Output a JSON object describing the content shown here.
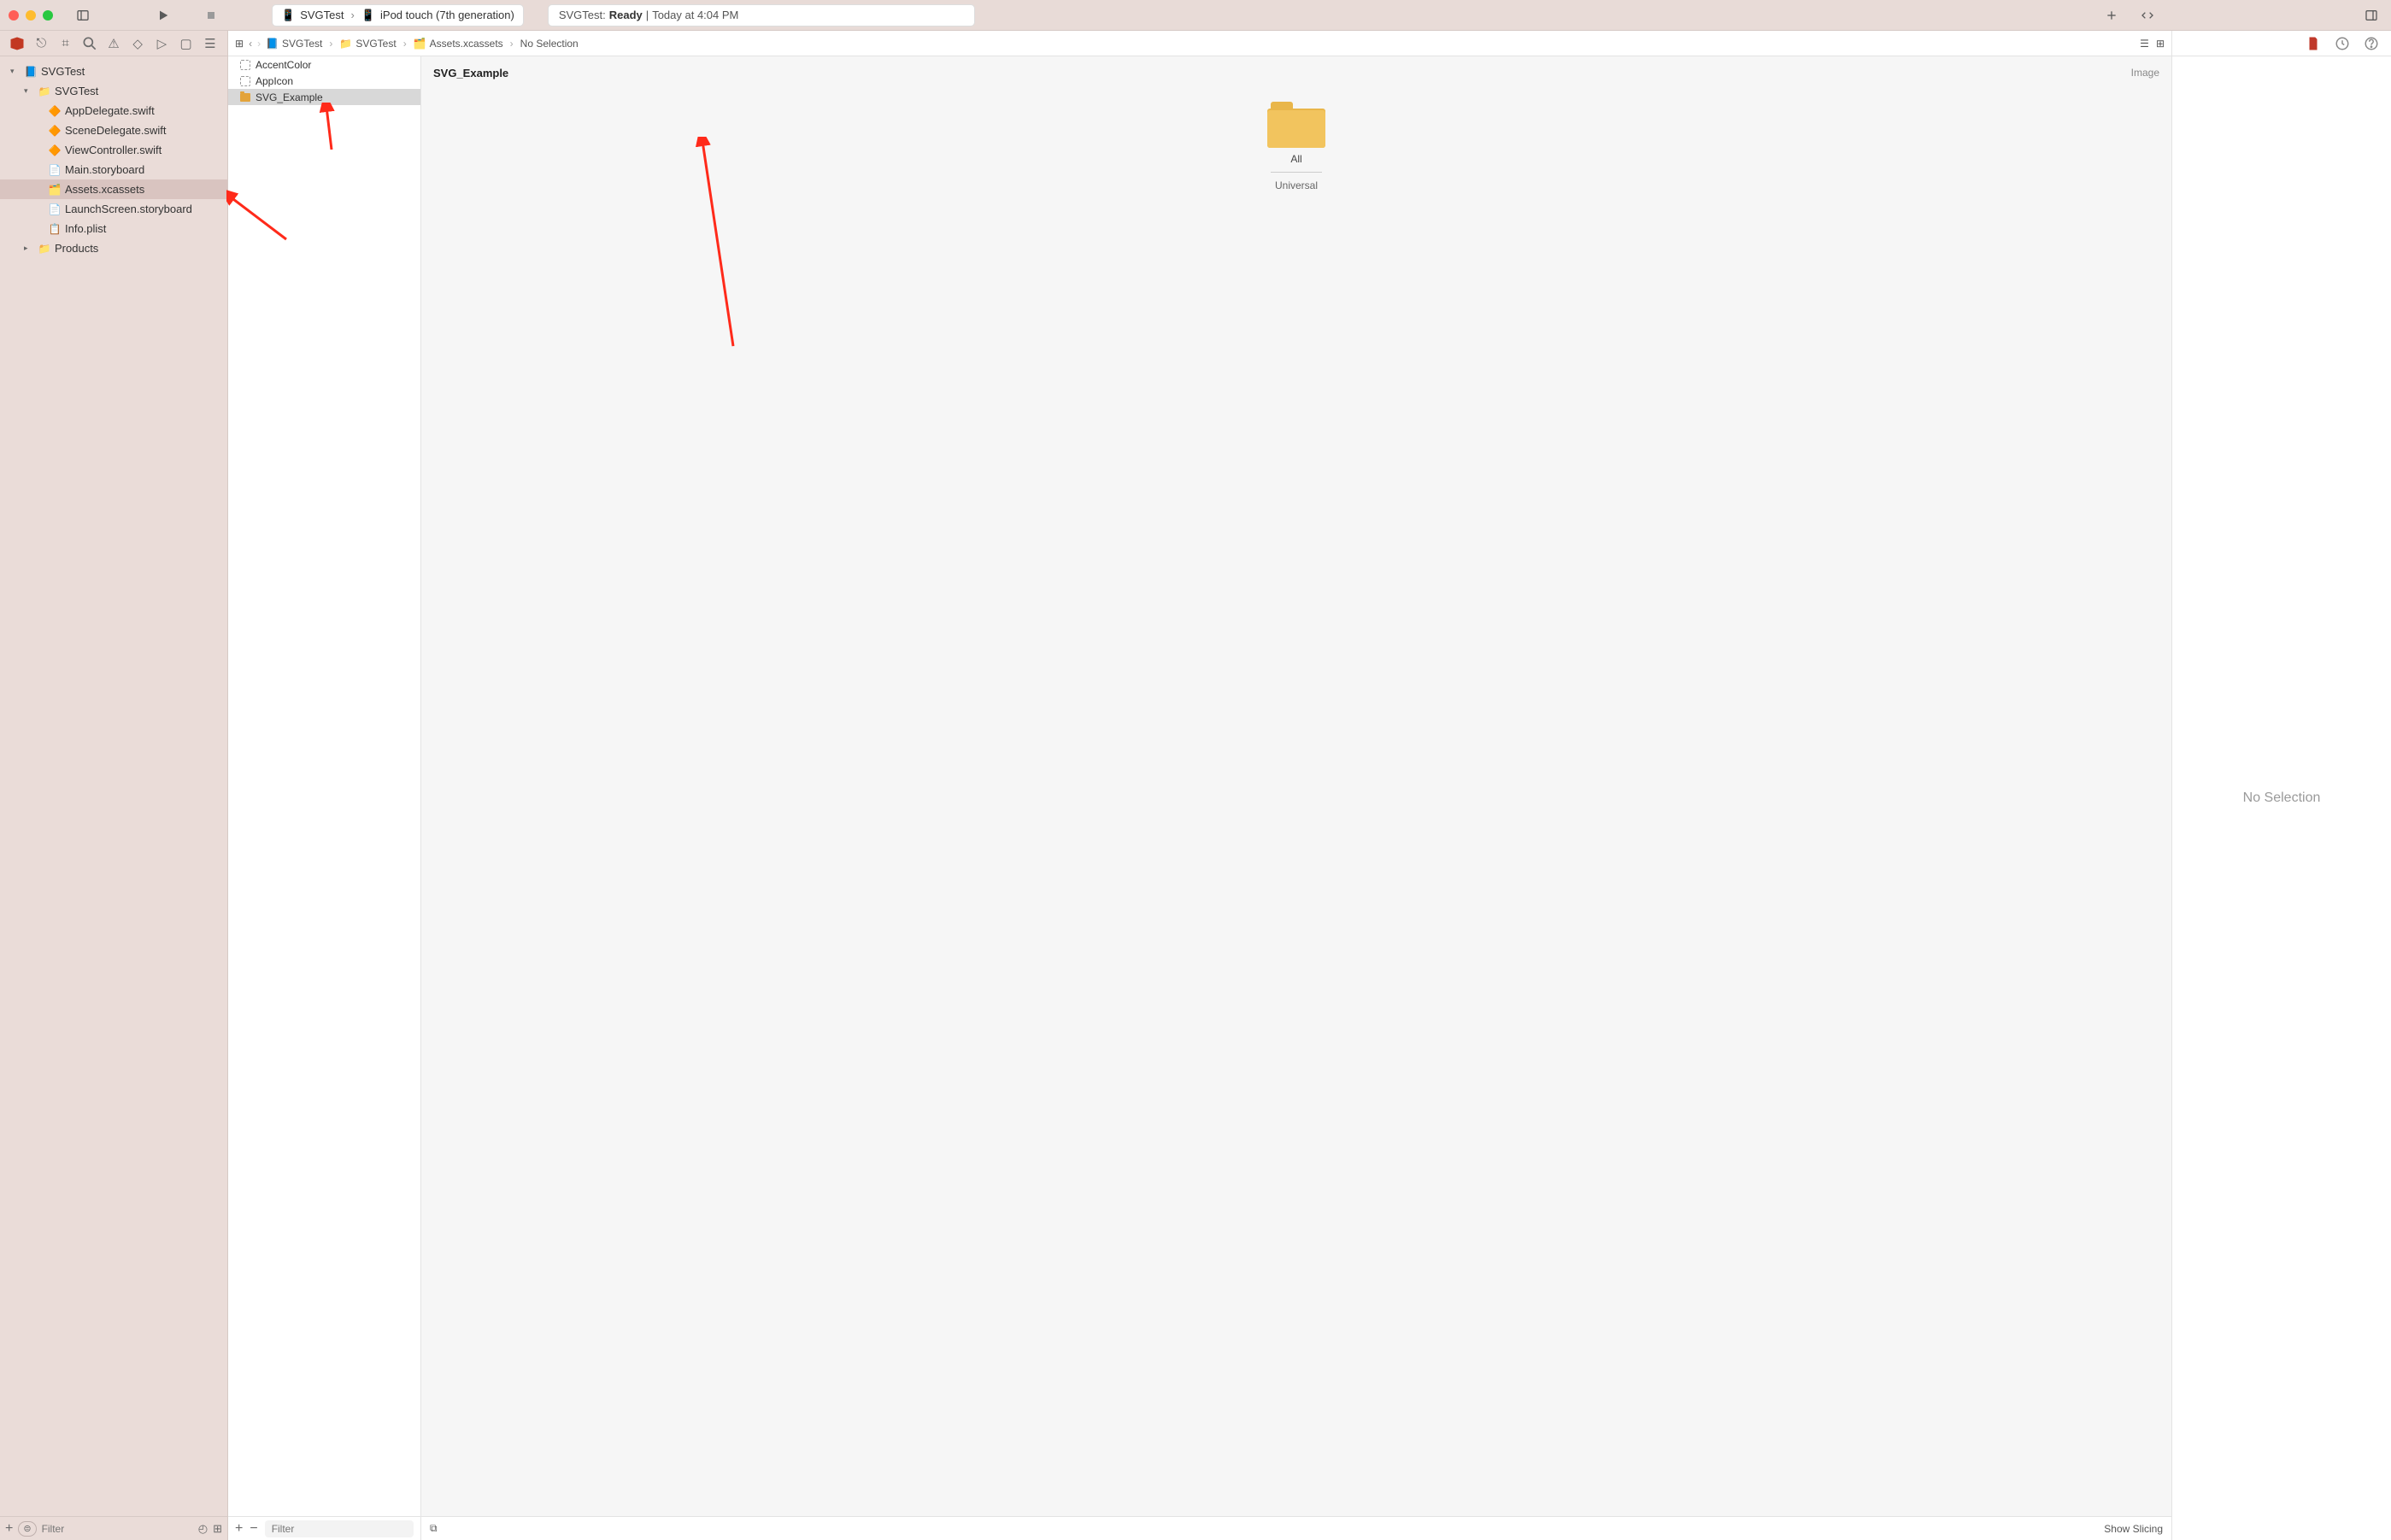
{
  "titlebar": {
    "scheme": "SVGTest",
    "device": "iPod touch (7th generation)",
    "status_prefix": "SVGTest:",
    "status_state": "Ready",
    "status_sep": "|",
    "status_time": "Today at 4:04 PM"
  },
  "nav": {
    "filter_placeholder": "Filter",
    "tree": {
      "root": "SVGTest",
      "group": "SVGTest",
      "files": [
        "AppDelegate.swift",
        "SceneDelegate.swift",
        "ViewController.swift",
        "Main.storyboard",
        "Assets.xcassets",
        "LaunchScreen.storyboard",
        "Info.plist"
      ],
      "products": "Products"
    }
  },
  "jumpbar": {
    "c1": "SVGTest",
    "c2": "SVGTest",
    "c3": "Assets.xcassets",
    "c4": "No Selection"
  },
  "assets": {
    "items": [
      "AccentColor",
      "AppIcon",
      "SVG_Example"
    ],
    "filter_placeholder": "Filter"
  },
  "canvas": {
    "title": "SVG_Example",
    "type": "Image",
    "slot_label": "All",
    "slot_sub": "Universal",
    "show_slicing": "Show Slicing"
  },
  "inspector": {
    "empty": "No Selection"
  }
}
